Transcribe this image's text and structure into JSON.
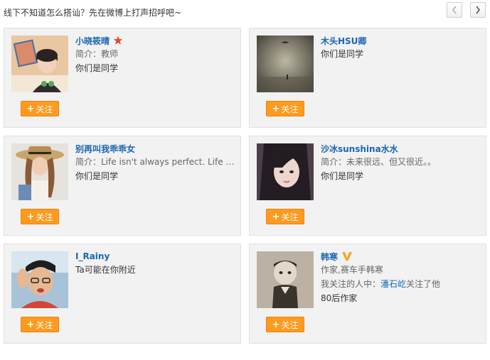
{
  "header": {
    "title": "线下不知道怎么搭讪？先在微博上打声招呼吧~"
  },
  "follow_label": "关注",
  "cards": [
    {
      "name": "小晓筱晴",
      "badge": "star",
      "lines": [
        "简介：教师",
        "你们是同学"
      ]
    },
    {
      "name": "木头HSU卿",
      "lines": [
        "你们是同学"
      ]
    },
    {
      "name": "别再叫我乖乖女",
      "lines": [
        "简介：Life isn't always perfect. Life is...",
        "你们是同学"
      ]
    },
    {
      "name": "沙冰sunshina水水",
      "lines": [
        "简介：未来很远、但又很近。。",
        "你们是同学"
      ]
    },
    {
      "name": "I_Rainy",
      "lines": [
        "Ta可能在你附近"
      ]
    },
    {
      "name": "韩寒",
      "badge": "V",
      "lines": [
        "作家,赛车手韩寒"
      ],
      "mutual": {
        "prefix": "我关注的人中：",
        "user": "潘石屹",
        "suffix": "关注了他"
      },
      "last_line": "80后作家"
    }
  ],
  "colors": {
    "link": "#1a66b3",
    "follow_button": "#ff9a1e",
    "card_bg": "#f2f2f2",
    "star": "#e8452c",
    "verified": "#f5a623"
  }
}
